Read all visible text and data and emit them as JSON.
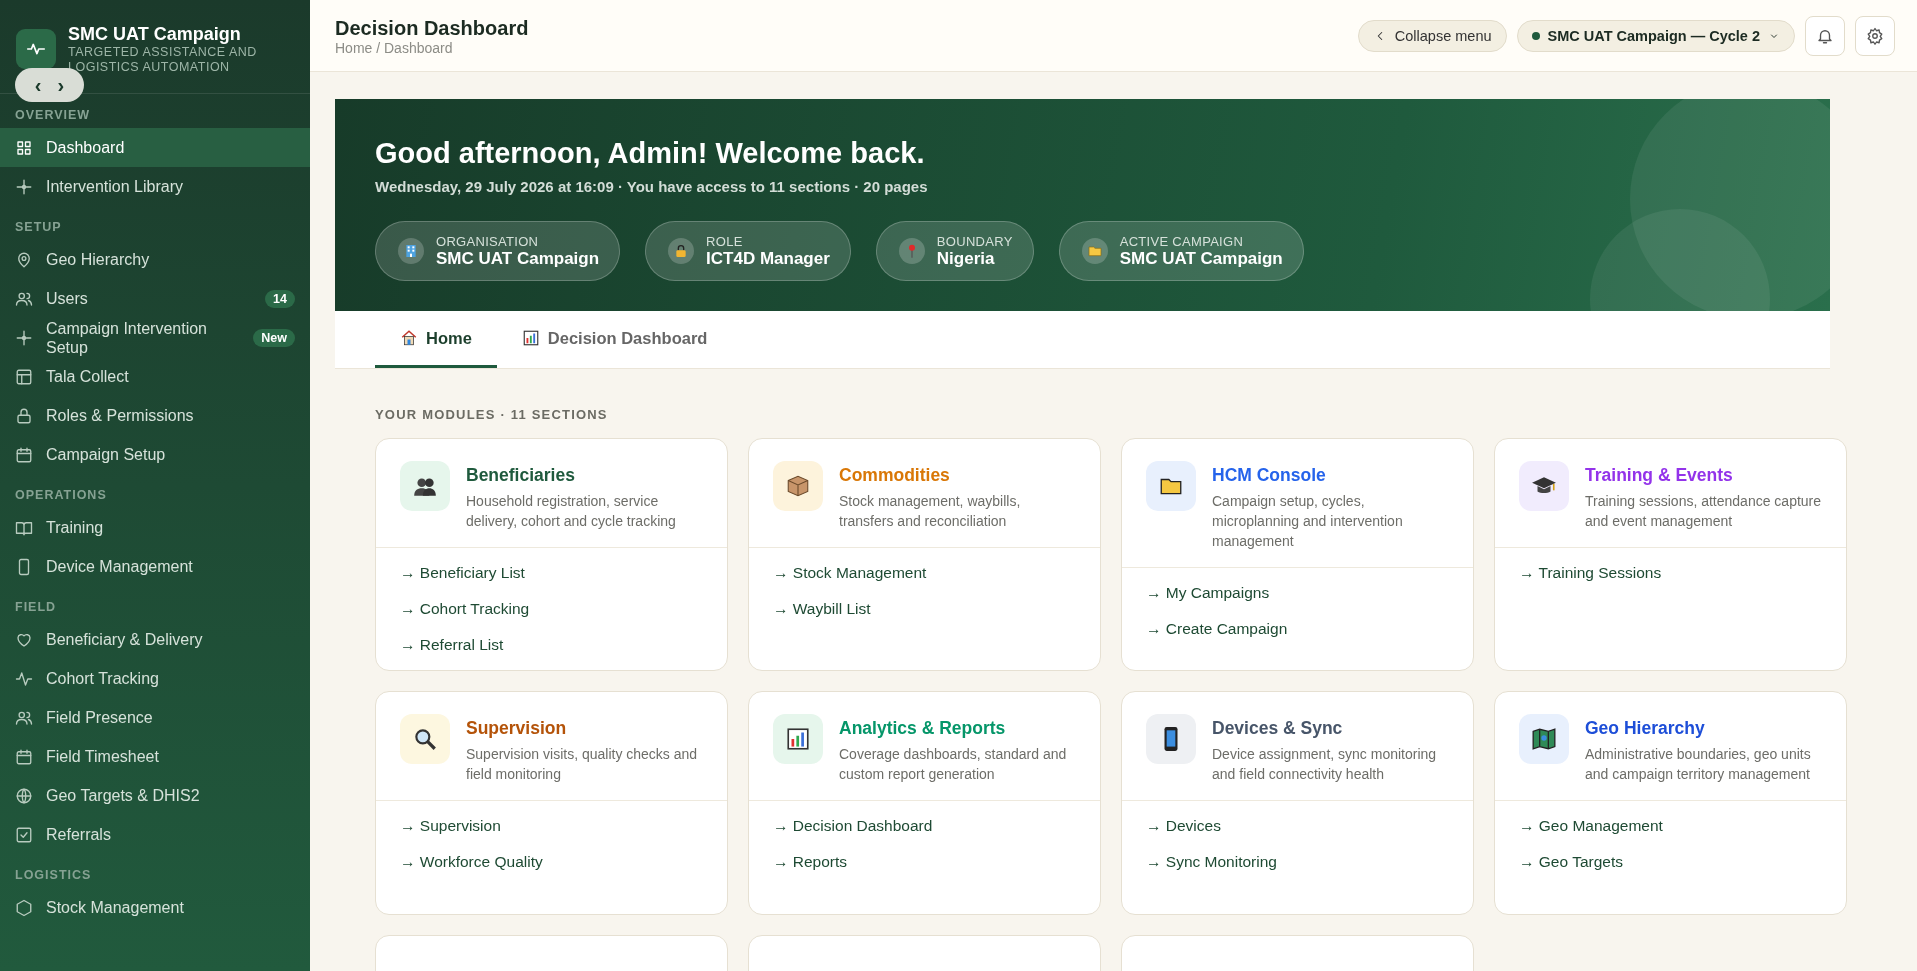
{
  "sidebar": {
    "brand": {
      "title": "SMC UAT Campaign",
      "subtitle": "TARGETED ASSISTANCE AND LOGISTICS AUTOMATION"
    },
    "toggle": {
      "prev": "‹",
      "next": "›"
    },
    "sections": [
      {
        "title": "OVERVIEW",
        "items": [
          {
            "label": "Dashboard",
            "selected": true
          },
          {
            "label": "Intervention Library",
            "selected": false
          }
        ]
      },
      {
        "title": "SETUP",
        "items": [
          {
            "label": "Geo Hierarchy",
            "selected": false
          },
          {
            "label": "Users",
            "selected": false,
            "badge": "14"
          },
          {
            "label": "Campaign Intervention Setup",
            "selected": false,
            "badge": "New"
          },
          {
            "label": "Tala Collect",
            "selected": false
          },
          {
            "label": "Roles & Permissions",
            "selected": false
          },
          {
            "label": "Campaign Setup",
            "selected": false
          }
        ]
      },
      {
        "title": "OPERATIONS",
        "items": [
          {
            "label": "Training",
            "selected": false
          },
          {
            "label": "Device Management",
            "selected": false
          }
        ]
      },
      {
        "title": "FIELD",
        "items": [
          {
            "label": "Beneficiary & Delivery",
            "selected": false
          },
          {
            "label": "Cohort Tracking",
            "selected": false
          },
          {
            "label": "Field Presence",
            "selected": false
          },
          {
            "label": "Field Timesheet",
            "selected": false
          },
          {
            "label": "Geo Targets & DHIS2",
            "selected": false
          },
          {
            "label": "Referrals",
            "selected": false
          }
        ]
      },
      {
        "title": "LOGISTICS",
        "items": [
          {
            "label": "Stock Management",
            "selected": false
          }
        ]
      }
    ]
  },
  "header": {
    "title": "Decision Dashboard",
    "breadcrumb": "Home / Dashboard",
    "collapse_button": "Collapse menu",
    "campaign_selector": "SMC UAT Campaign — Cycle 2"
  },
  "banner": {
    "greeting": "Good afternoon, Admin! Welcome back.",
    "subtitle": "Wednesday, 29 July 2026 at 16:09  ·  You have access to 11 sections · 20 pages",
    "chips": [
      {
        "label": "ORGANISATION",
        "value": "SMC UAT Campaign"
      },
      {
        "label": "ROLE",
        "value": "ICT4D Manager"
      },
      {
        "label": "BOUNDARY",
        "value": "Nigeria"
      },
      {
        "label": "ACTIVE CAMPAIGN",
        "value": "SMC UAT Campaign"
      }
    ]
  },
  "tabs": [
    {
      "label": "Home",
      "selected": true
    },
    {
      "label": "Decision Dashboard",
      "selected": false
    }
  ],
  "modules": {
    "heading": "YOUR MODULES · 11 SECTIONS",
    "cards": [
      {
        "kind": "module",
        "title": "Beneficiaries",
        "color": "#1f5a3d",
        "description": "Household registration, service delivery, cohort and cycle tracking",
        "links": [
          "→ Beneficiary List",
          "→ Cohort Tracking",
          "→ Referral List"
        ]
      },
      {
        "kind": "module",
        "title": "Commodities",
        "color": "#d97706",
        "description": "Stock management, waybills, transfers and reconciliation",
        "links": [
          "→ Stock Management",
          "→ Waybill List"
        ]
      },
      {
        "kind": "module",
        "title": "HCM Console",
        "color": "#2563eb",
        "description": "Campaign setup, cycles, microplanning and intervention management",
        "links": [
          "→ My Campaigns",
          "→ Create Campaign"
        ]
      },
      {
        "kind": "module",
        "title": "Training & Events",
        "color": "#9333ea",
        "description": "Training sessions, attendance capture and event management",
        "links": [
          "→ Training Sessions"
        ]
      },
      {
        "kind": "module",
        "title": "Supervision",
        "color": "#b45309",
        "description": "Supervision visits, quality checks and field monitoring",
        "links": [
          "→ Supervision",
          "→ Workforce Quality"
        ]
      },
      {
        "kind": "module",
        "title": "Analytics & Reports",
        "color": "#059669",
        "description": "Coverage dashboards, standard and custom report generation",
        "links": [
          "→ Decision Dashboard",
          "→ Reports"
        ]
      },
      {
        "kind": "module",
        "title": "Devices & Sync",
        "color": "#475569",
        "description": "Device assignment, sync monitoring and field connectivity health",
        "links": [
          "→ Devices",
          "→ Sync Monitoring"
        ]
      },
      {
        "kind": "module",
        "title": "Geo Hierarchy",
        "color": "#1d4ed8",
        "description": "Administrative boundaries, geo units and campaign territory management",
        "links": [
          "→ Geo Management",
          "→ Geo Targets"
        ]
      },
      {
        "kind": "clipped"
      },
      {
        "kind": "clipped"
      },
      {
        "kind": "clipped"
      }
    ]
  }
}
